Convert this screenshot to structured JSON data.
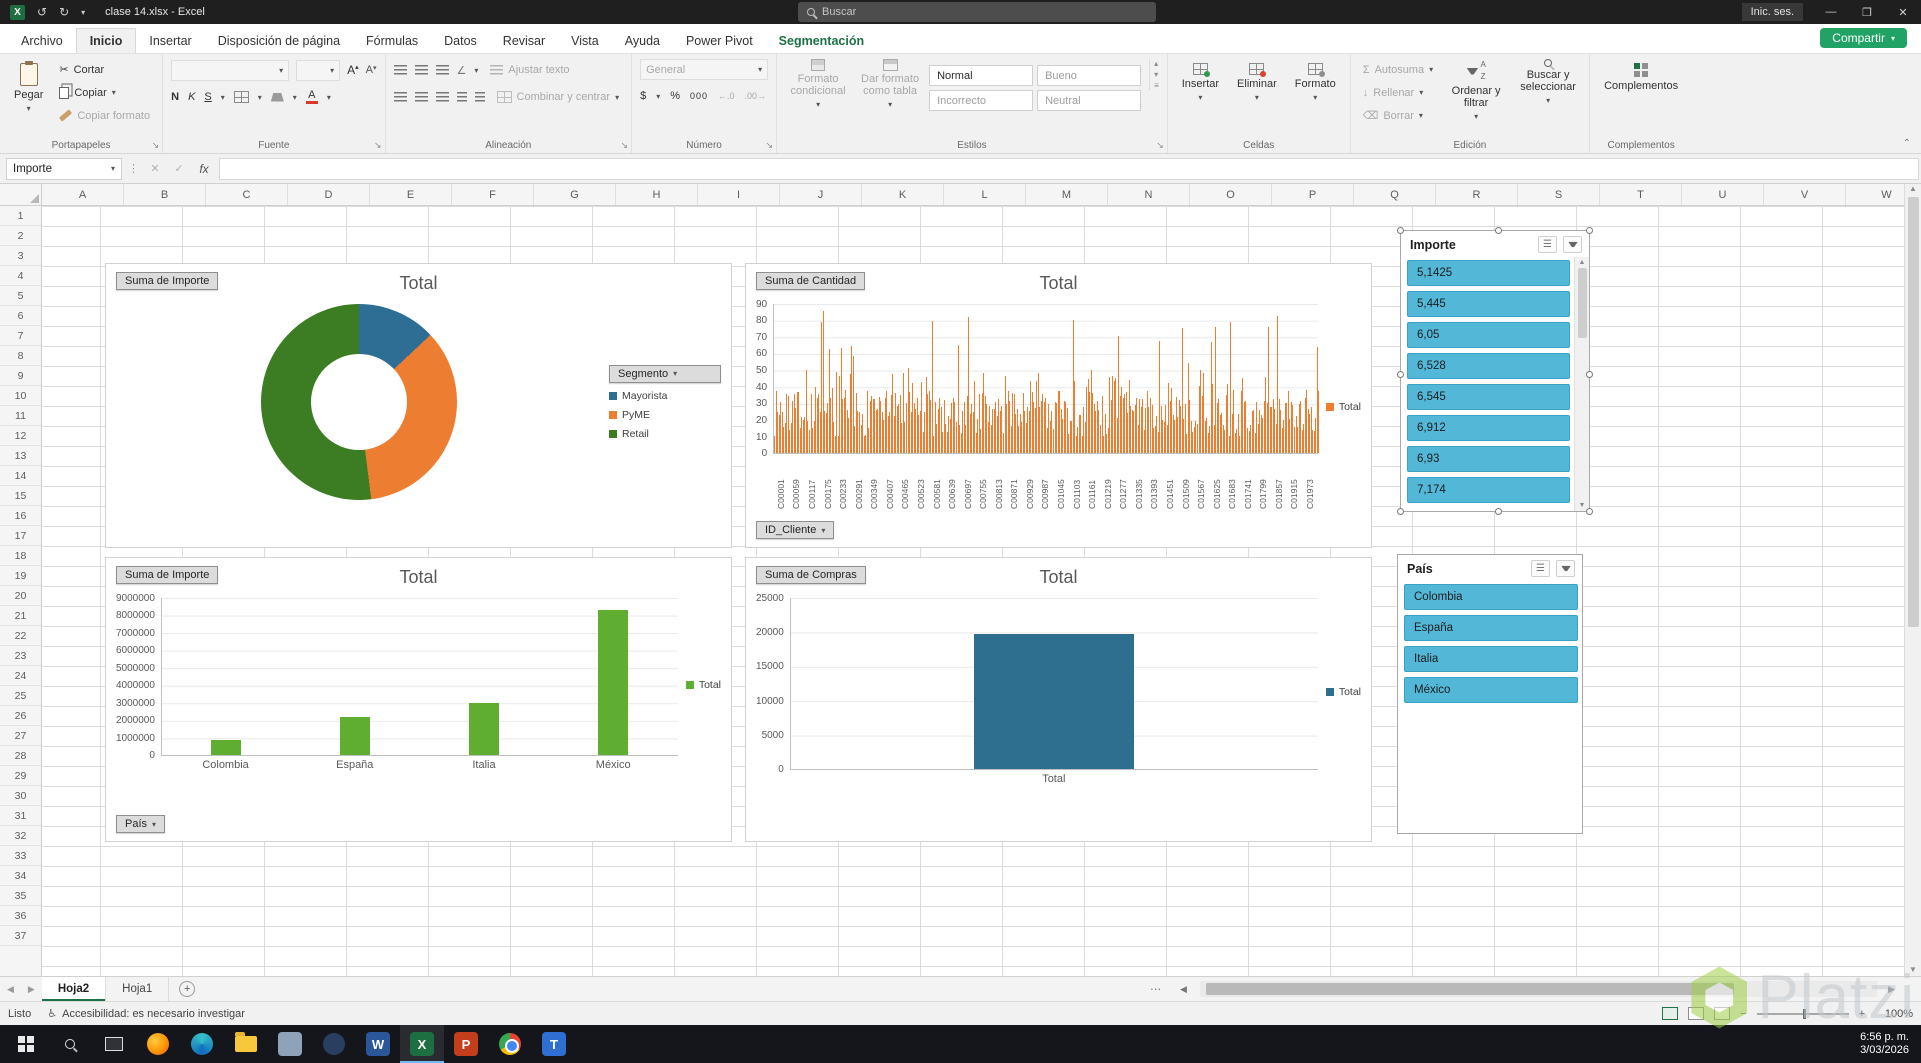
{
  "title_bar": {
    "title": "clase 14.xlsx  -  Excel",
    "search_placeholder": "Buscar",
    "sign_in_label": "Inic. ses."
  },
  "ribbon": {
    "tabs": [
      "Archivo",
      "Inicio",
      "Insertar",
      "Disposición de página",
      "Fórmulas",
      "Datos",
      "Revisar",
      "Vista",
      "Ayuda",
      "Power Pivot",
      "Segmentación"
    ],
    "active_tab": "Inicio",
    "contextual_tab": "Segmentación",
    "share_button_label": "Compartir",
    "groups": {
      "clipboard": {
        "label": "Portapapeles",
        "paste": "Pegar",
        "cut": "Cortar",
        "copy": "Copiar",
        "format_painter": "Copiar formato"
      },
      "font": {
        "label": "Fuente",
        "font_name_value": "",
        "font_size_value": "",
        "bold": "N",
        "italic": "K",
        "underline": "S"
      },
      "alignment": {
        "label": "Alineación",
        "wrap_text": "Ajustar texto",
        "merge_center": "Combinar y centrar"
      },
      "number": {
        "label": "Número",
        "format_value": "General",
        "currency": "$",
        "percent": "%",
        "thousands": "000"
      },
      "styles": {
        "label": "Estilos",
        "conditional_format": "Formato condicional",
        "format_as_table": "Dar formato como tabla",
        "style_cells": [
          "Normal",
          "Bueno",
          "Incorrecto",
          "Neutral"
        ]
      },
      "cells": {
        "label": "Celdas",
        "insert": "Insertar",
        "delete": "Eliminar",
        "format": "Formato"
      },
      "editing": {
        "label": "Edición",
        "autosum": "Autosuma",
        "fill": "Rellenar",
        "clear": "Borrar",
        "sort_filter": "Ordenar y filtrar",
        "find_select": "Buscar y seleccionar"
      },
      "addins": {
        "label": "Complementos",
        "addins_button": "Complementos"
      }
    }
  },
  "formula_bar": {
    "name_box_value": "Importe",
    "fx_label": "fx",
    "formula_value": ""
  },
  "grid": {
    "columns": [
      "A",
      "B",
      "C",
      "D",
      "E",
      "F",
      "G",
      "H",
      "I",
      "J",
      "K",
      "L",
      "M",
      "N",
      "O",
      "P",
      "Q",
      "R",
      "S",
      "T",
      "U",
      "V",
      "W"
    ],
    "rows": [
      1,
      2,
      3,
      4,
      5,
      6,
      7,
      8,
      9,
      10,
      11,
      12,
      13,
      14,
      15,
      16,
      17,
      18,
      19,
      20,
      21,
      22,
      23,
      24,
      25,
      26,
      27,
      28,
      29,
      30,
      31,
      32,
      33,
      34,
      35,
      36,
      37
    ]
  },
  "chart_data": [
    {
      "type": "pie",
      "subtype": "donut",
      "title": "Total",
      "pivot_field_button": "Suma de Importe",
      "legend_field_button": "Segmento",
      "legend_position": "right",
      "segments": [
        {
          "name": "Mayorista",
          "color": "#2e6e94",
          "pct": 13
        },
        {
          "name": "PyME",
          "color": "#ED7D31",
          "pct": 35
        },
        {
          "name": "Retail",
          "color": "#3c7d23",
          "pct": 52
        }
      ]
    },
    {
      "type": "bar",
      "title": "Total",
      "pivot_field_button": "Suma de Cantidad",
      "axis_field_button": "ID_Cliente",
      "series_name": "Total",
      "color": "#ED7D31",
      "ylim": [
        0,
        90
      ],
      "ytick_labels": [
        "90",
        "80",
        "70",
        "60",
        "50",
        "40",
        "30",
        "20",
        "10",
        "0"
      ],
      "dense_series": true,
      "approx_bar_count": 360,
      "approx_value_range": [
        10,
        88
      ],
      "x_tick_labels": [
        "C00001",
        "C00059",
        "C00117",
        "C00175",
        "C00233",
        "C00291",
        "C00349",
        "C00407",
        "C00465",
        "C00523",
        "C00581",
        "C00639",
        "C00697",
        "C00755",
        "C00813",
        "C00871",
        "C00929",
        "C00987",
        "C01045",
        "C01103",
        "C01161",
        "C01219",
        "C01277",
        "C01335",
        "C01393",
        "C01451",
        "C01509",
        "C01567",
        "C01625",
        "C01683",
        "C01741",
        "C01799",
        "C01857",
        "C01915",
        "C01973"
      ]
    },
    {
      "type": "bar",
      "title": "Total",
      "pivot_field_button": "Suma de Importe",
      "axis_field_button": "País",
      "series_name": "Total",
      "color": "#5fae32",
      "ylim": [
        0,
        9000000
      ],
      "ytick_labels": [
        "9000000",
        "8000000",
        "7000000",
        "6000000",
        "5000000",
        "4000000",
        "3000000",
        "2000000",
        "1000000",
        "0"
      ],
      "categories": [
        "Colombia",
        "España",
        "Italia",
        "México"
      ],
      "values": [
        850000,
        2200000,
        3000000,
        8300000
      ]
    },
    {
      "type": "bar",
      "title": "Total",
      "pivot_field_button": "Suma de Compras",
      "series_name": "Total",
      "color": "#2e6e8e",
      "ylim": [
        0,
        25000
      ],
      "ytick_labels": [
        "25000",
        "20000",
        "15000",
        "10000",
        "5000",
        "0"
      ],
      "categories": [
        "Total"
      ],
      "values": [
        19800
      ]
    }
  ],
  "slicers": [
    {
      "title": "Importe",
      "items": [
        "5,1425",
        "5,445",
        "6,05",
        "6,528",
        "6,545",
        "6,912",
        "6,93",
        "7,174"
      ]
    },
    {
      "title": "País",
      "items": [
        "Colombia",
        "España",
        "Italia",
        "México"
      ]
    }
  ],
  "sheet_tabs": {
    "tabs": [
      "Hoja2",
      "Hoja1"
    ],
    "active_tab": "Hoja2",
    "add_label": "+",
    "ellipsis": "⋯"
  },
  "status_bar": {
    "mode": "Listo",
    "accessibility": "Accesibilidad: es necesario investigar",
    "zoom_level": "100%"
  },
  "taskbar": {
    "time": "6:56 p. m.",
    "date": "3/03/2026"
  },
  "watermark_text": "Platzi"
}
